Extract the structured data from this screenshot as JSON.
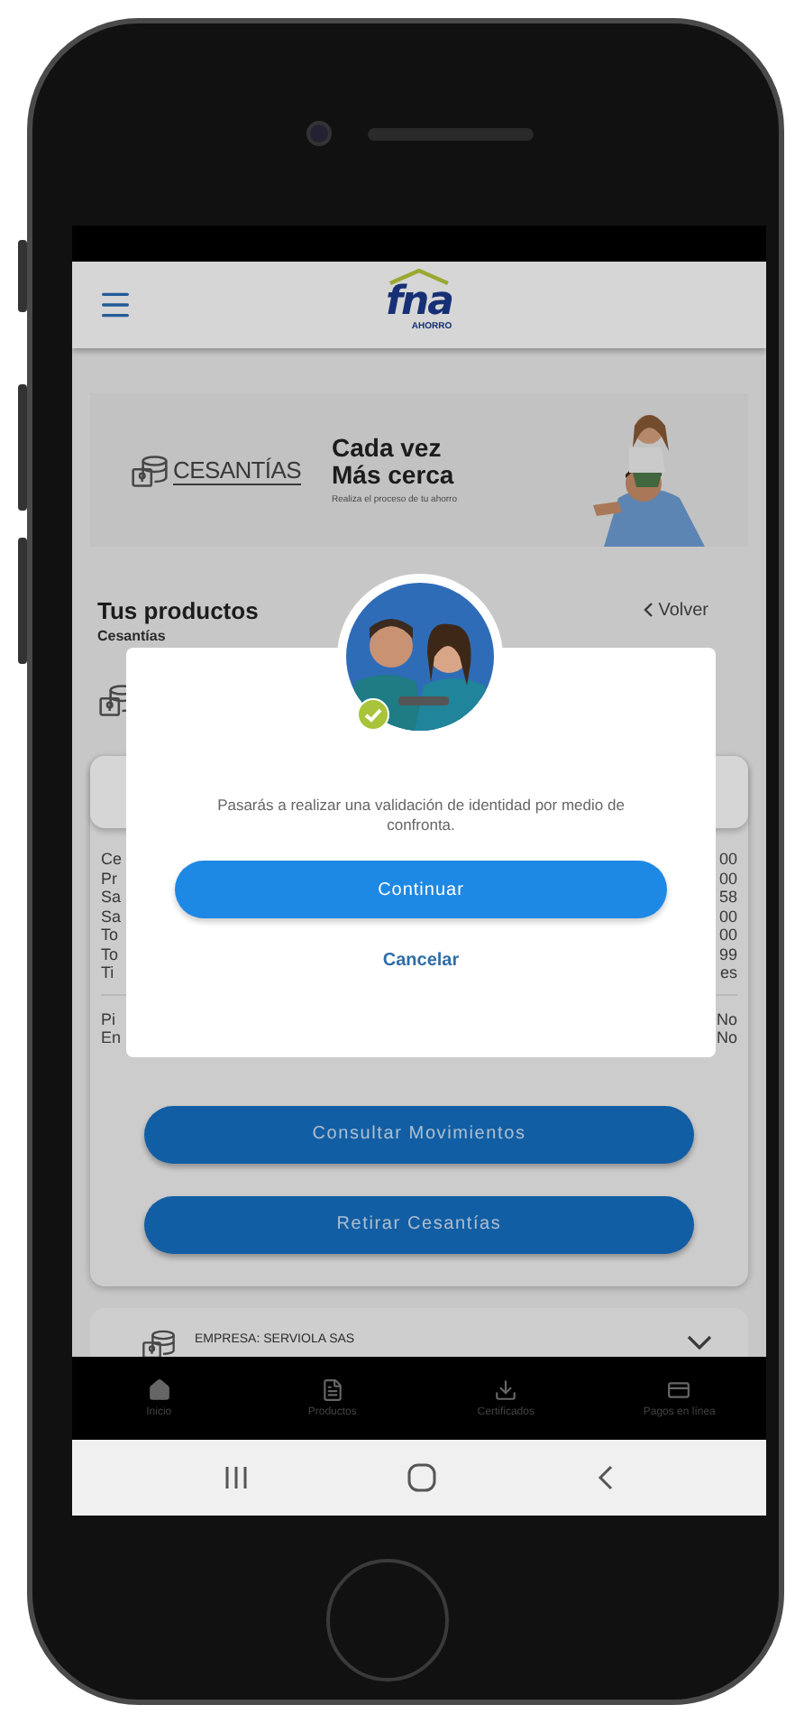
{
  "header": {
    "logo": "fna",
    "logo_tagline": "AHORRO"
  },
  "banner": {
    "brand": "CESANTÍAS",
    "headline": [
      "Cada vez",
      "Más cerca"
    ],
    "subline": "Realiza el proceso de tu ahorro"
  },
  "products": {
    "title": "Tus productos",
    "subtitle": "Cesantías",
    "back": "Volver"
  },
  "details": {
    "rows": [
      {
        "label": "Ce",
        "value": "00"
      },
      {
        "label": "Pr",
        "value": "00"
      },
      {
        "label": "Sa",
        "value": "58"
      },
      {
        "label": "Sa",
        "value": "00"
      },
      {
        "label": "To",
        "value": "00"
      },
      {
        "label": "To",
        "value": "99"
      },
      {
        "label": "Ti",
        "value": "es"
      }
    ],
    "flags": [
      {
        "label": "Pi",
        "value": "No"
      },
      {
        "label": "En",
        "value": "No"
      }
    ]
  },
  "actions": [
    "Consultar Movimientos",
    "Retirar Cesantías"
  ],
  "employer": {
    "label": "EMPRESA: SERVIOLA SAS",
    "expanded": false
  },
  "bottom_nav": [
    {
      "kind": "home",
      "label": "Inicio"
    },
    {
      "kind": "products",
      "label": "Productos"
    },
    {
      "kind": "download",
      "label": "Certificados"
    },
    {
      "kind": "card",
      "label": "Pagos en línea"
    }
  ],
  "dialog": {
    "message": "Pasarás a realizar una validación de identidad por medio de confronta.",
    "primary": "Continuar",
    "secondary": "Cancelar"
  }
}
